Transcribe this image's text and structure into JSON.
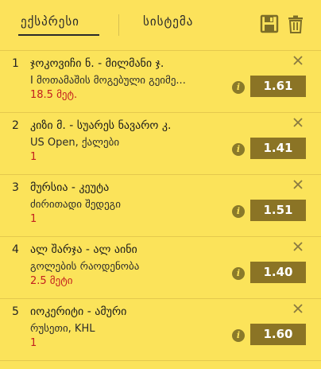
{
  "tabs": {
    "express_label": "ექსპრესი",
    "system_label": "სისტემა"
  },
  "toolbar": {
    "save_icon": "floppy-disk-icon",
    "trash_icon": "trash-icon"
  },
  "colors": {
    "background": "#fbe35a",
    "odds_bg": "#8b7425",
    "pick_text": "#c31f1f"
  },
  "slips": [
    {
      "num": "1",
      "title": "ჯოკოვიჩი ნ. - მილმანი ჯ.",
      "subtitle": "I მოთამაშის მოგებული გეიმე...",
      "pick": "18.5 მეტ.",
      "odds": "1.61"
    },
    {
      "num": "2",
      "title": "კიზი მ. - სუარეს ნავარო კ.",
      "subtitle": "US Open, ქალები",
      "pick": "1",
      "odds": "1.41"
    },
    {
      "num": "3",
      "title": "მურსია - კეუტა",
      "subtitle": "ძირითადი შედეგი",
      "pick": "1",
      "odds": "1.51"
    },
    {
      "num": "4",
      "title": "ალ შარჯა - ალ აინი",
      "subtitle": "გოლების რაოდენობა",
      "pick": "2.5 მეტი",
      "odds": "1.40"
    },
    {
      "num": "5",
      "title": "იოკერიტი - ამური",
      "subtitle": "რუსეთი, KHL",
      "pick": "1",
      "odds": "1.60"
    }
  ]
}
